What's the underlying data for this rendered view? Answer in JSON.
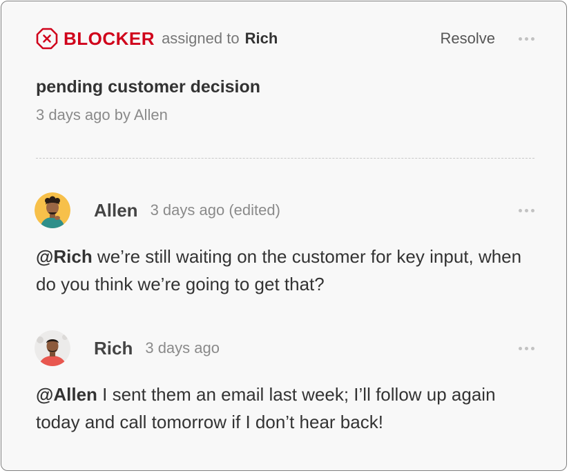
{
  "blocker": {
    "icon": "x-octagon-icon",
    "label": "BLOCKER",
    "assigned_text": "assigned to",
    "assignee": "Rich",
    "resolve_label": "Resolve",
    "title": "pending customer decision",
    "meta": "3 days ago by Allen"
  },
  "comments": [
    {
      "author": "Allen",
      "time": "3 days ago (edited)",
      "mention": "@Rich",
      "text": " we’re still waiting on the customer for key input, when do you think we’re going to get that?"
    },
    {
      "author": "Rich",
      "time": "3 days ago",
      "mention": "@Allen",
      "text": " I sent them an email last week; I’ll follow up again today and call tomorrow if I don’t hear back!"
    }
  ],
  "colors": {
    "blocker_red": "#d0021b",
    "card_background": "#f8f8f8",
    "border": "#7f7f7f",
    "muted_text": "#8a8a8a"
  }
}
